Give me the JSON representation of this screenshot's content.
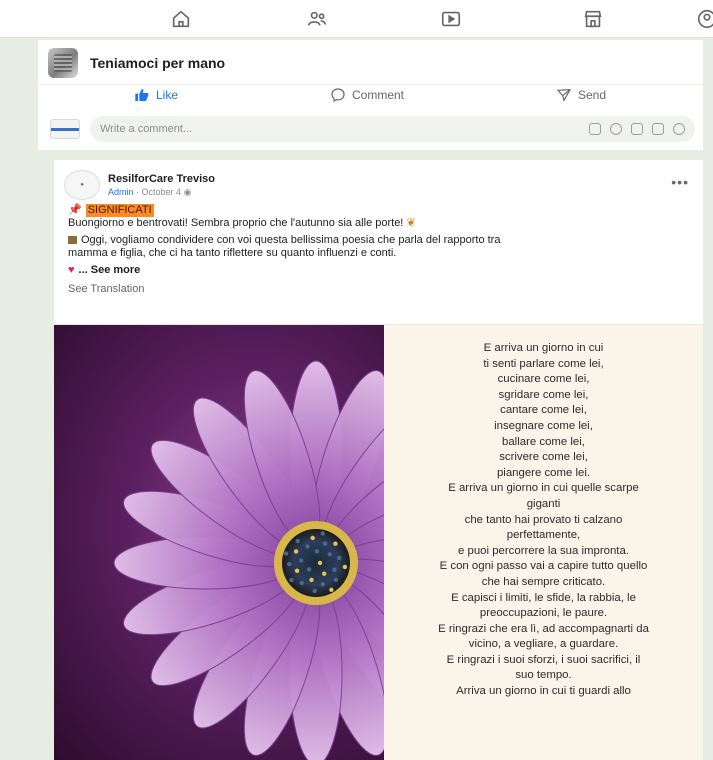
{
  "top_nav": {
    "icons": [
      "home-icon",
      "friends-icon",
      "video-icon",
      "marketplace-icon",
      "groups-icon"
    ]
  },
  "previous_post": {
    "group_name": "Teniamoci per mano",
    "actions": {
      "like": "Like",
      "comment": "Comment",
      "send": "Send"
    },
    "comment_placeholder": "Write a comment..."
  },
  "post": {
    "author": "ResilforCare Treviso",
    "role": "Admin",
    "date": "October 4",
    "tag": "SIGNIFICATI",
    "line1": "Buongiorno e bentrovati! Sembra proprio che l'autunno sia alle porte!",
    "line2": "Oggi, vogliamo condividere con voi questa bellissima poesia che parla del rapporto tra",
    "line3": "mamma e figlia, che ci ha tanto riflettere su quanto influenzi e conti.",
    "see_more": "... See more",
    "see_translation": "See Translation",
    "more_label": "•••",
    "poem_lines": [
      "E arriva un giorno in cui",
      "ti senti parlare come lei,",
      "cucinare come lei,",
      "sgridare come lei,",
      "cantare come lei,",
      "insegnare come lei,",
      "ballare come lei,",
      "scrivere come lei,",
      "piangere come lei.",
      "E arriva un giorno in cui quelle scarpe",
      "giganti",
      "che tanto hai provato ti calzano",
      "perfettamente,",
      "e puoi percorrere la sua impronta.",
      "E con ogni passo vai a capire tutto quello",
      "che hai sempre criticato.",
      "E capisci i limiti, le sfide, la rabbia, le",
      "preoccupazioni, le paure.",
      "E ringrazi che era lì, ad accompagnarti da",
      "vicino, a vegliare, a guardare.",
      "E ringrazi i suoi sforzi, i suoi sacrifici, il",
      "suo tempo.",
      "Arriva un giorno in cui ti guardi allo"
    ]
  },
  "colors": {
    "accent": "#1877f2",
    "tag_bg": "#ff8a1f",
    "page_bg": "#e8ede4",
    "poem_bg": "#fbf5e9"
  }
}
